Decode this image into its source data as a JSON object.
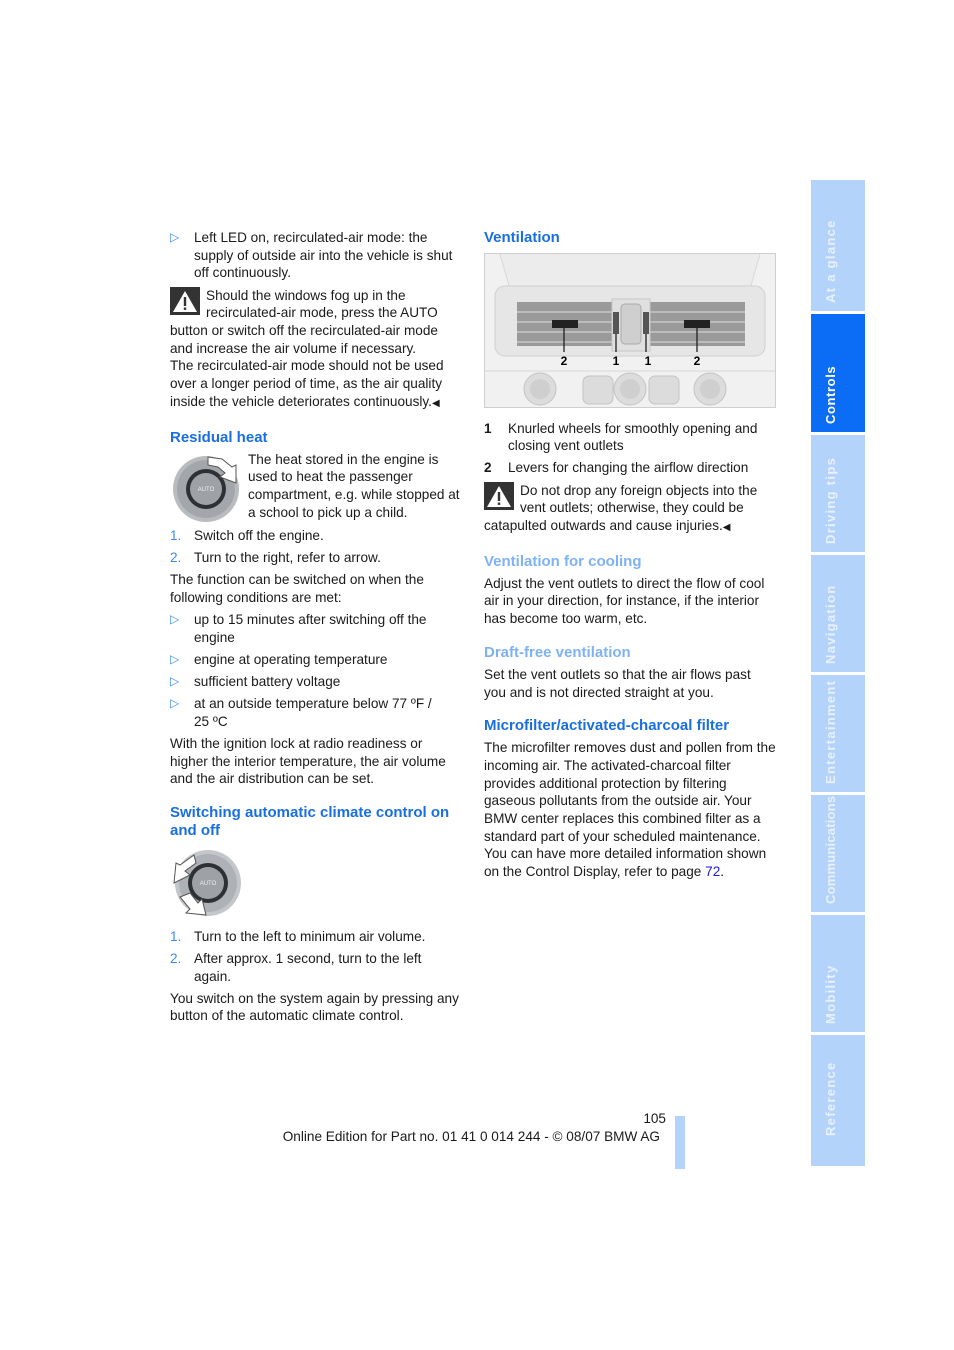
{
  "page": {
    "number": "105",
    "footer": "Online Edition for Part no. 01 41 0 014 244 - © 08/07 BMW AG",
    "accent_color": "#1a6fe0",
    "subheading_color": "#7fb2f5"
  },
  "left": {
    "bullet_led": "Left LED on, recirculated-air mode: the supply of outside air into the vehicle is shut off continuously.",
    "warning_fog": "Should the windows fog up in the recirculated-air mode, press the AUTO button or switch off the recirculated-air mode and increase the air volume if necessary.",
    "warning_fog_cont": "The recirculated-air mode should not be used over a longer period of time, as the air quality inside the vehicle deteriorates continuously.",
    "residual_heat": {
      "heading": "Residual heat",
      "intro": "The heat stored in the engine is used to heat the passenger compartment, e.g. while stopped at a school to pick up a child.",
      "steps": [
        {
          "num": "1.",
          "text": "Switch off the engine."
        },
        {
          "num": "2.",
          "text": "Turn to the right, refer to arrow."
        }
      ],
      "conditions_intro": "The function can be switched on when the following conditions are met:",
      "conditions": [
        "up to 15 minutes after switching off the engine",
        "engine at operating temperature",
        "sufficient battery voltage",
        "at an outside temperature below 77 ºF / 25 ºC"
      ],
      "note": "With the ignition lock at radio readiness or higher the interior temperature, the air volume and the air distribution can be set.",
      "dial_label": "AUTO"
    },
    "switching": {
      "heading": "Switching automatic climate control on and off",
      "steps": [
        {
          "num": "1.",
          "text": "Turn to the left to minimum air volume."
        },
        {
          "num": "2.",
          "text": "After approx. 1 second, turn to the left again."
        }
      ],
      "note": "You switch on the system again by pressing any button of the automatic climate control.",
      "dial_label": "AUTO"
    }
  },
  "right": {
    "ventilation": {
      "heading": "Ventilation",
      "callouts": [
        "2",
        "1",
        "1",
        "2"
      ],
      "legend": [
        {
          "num": "1",
          "text": "Knurled wheels for smoothly opening and closing vent outlets"
        },
        {
          "num": "2",
          "text": "Levers for changing the airflow direction"
        }
      ],
      "warning": "Do not drop any foreign objects into the vent outlets; otherwise, they could be catapulted outwards and cause injuries."
    },
    "cooling": {
      "heading": "Ventilation for cooling",
      "text": "Adjust the vent outlets to direct the flow of cool air in your direction, for instance, if the interior has become too warm, etc."
    },
    "draft_free": {
      "heading": "Draft-free ventilation",
      "text": "Set the vent outlets so that the air flows past you and is not directed straight at you."
    },
    "microfilter": {
      "heading": "Microfilter/activated-charcoal filter",
      "text": "The microfilter removes dust and pollen from the incoming air. The activated-charcoal filter provides additional protection by filtering gaseous pollutants from the outside air. Your BMW center replaces this combined filter as a standard part of your scheduled maintenance.",
      "text2": "You can have more detailed information shown on the Control Display, refer to page ",
      "page_ref": "72",
      "text2_end": "."
    }
  },
  "sidebar": {
    "tabs": [
      {
        "label": "At a glance",
        "active": false
      },
      {
        "label": "Controls",
        "active": true
      },
      {
        "label": "Driving tips",
        "active": false
      },
      {
        "label": "Navigation",
        "active": false
      },
      {
        "label": "Entertainment",
        "active": false
      },
      {
        "label": "Communications",
        "active": false
      },
      {
        "label": "Mobility",
        "active": false
      },
      {
        "label": "Reference",
        "active": false
      }
    ]
  }
}
